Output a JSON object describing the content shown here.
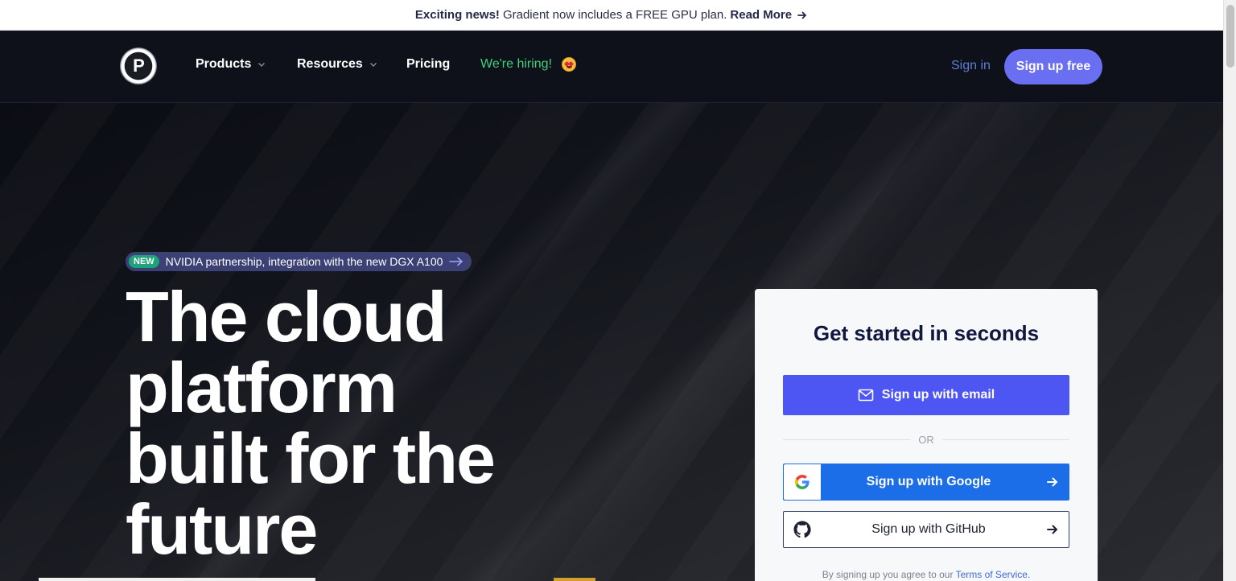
{
  "announcement": {
    "prefix": "Exciting news!",
    "text": "Gradient now includes a FREE GPU plan.",
    "link": "Read More"
  },
  "nav": {
    "logo_letter": "P",
    "items": [
      {
        "label": "Products"
      },
      {
        "label": "Resources"
      },
      {
        "label": "Pricing"
      }
    ],
    "hiring": "We're hiring!",
    "signin": "Sign in",
    "signup": "Sign up free"
  },
  "hero": {
    "pill_badge": "NEW",
    "pill_text": "NVIDIA partnership, integration with the new DGX A100",
    "headline_lines": [
      "The cloud",
      "platform",
      "built for the",
      "future"
    ]
  },
  "card": {
    "title": "Get started in seconds",
    "email_button": "Sign up with email",
    "or": "OR",
    "google_button": "Sign up with Google",
    "github_button": "Sign up with GitHub",
    "terms_prefix": "By signing up you agree to our",
    "terms_link": "Terms of Service."
  },
  "colors": {
    "accent": "#6a6ef0",
    "email_button": "#4d55f3",
    "google_button": "#1c6de8",
    "hiring": "#3fd07a",
    "signin": "#5e7fd8"
  },
  "icons": [
    "arrow-right-icon",
    "chevron-down-icon",
    "star-eyes-emoji-icon",
    "mail-icon",
    "google-icon",
    "github-icon"
  ]
}
